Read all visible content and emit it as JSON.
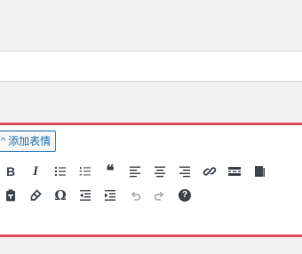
{
  "emoji_button": {
    "caret": "^",
    "label": "添加表情"
  },
  "toolbar": {
    "bold_label": "B",
    "italic_label": "I",
    "blockquote_label": "❝",
    "special_char_label": "Ω",
    "help_label": "?"
  },
  "colors": {
    "highlight_border": "#e05260",
    "accent": "#2271b1",
    "icon": "#3c434a",
    "icon_disabled": "#a7aaad"
  },
  "icons": [
    "bulleted-list-icon",
    "numbered-list-icon",
    "align-left-icon",
    "align-center-icon",
    "align-right-icon",
    "link-icon",
    "read-more-icon",
    "toolbar-toggle-icon",
    "paste-text-icon",
    "clear-formatting-icon",
    "outdent-icon",
    "indent-icon",
    "undo-icon",
    "redo-icon",
    "help-icon"
  ]
}
